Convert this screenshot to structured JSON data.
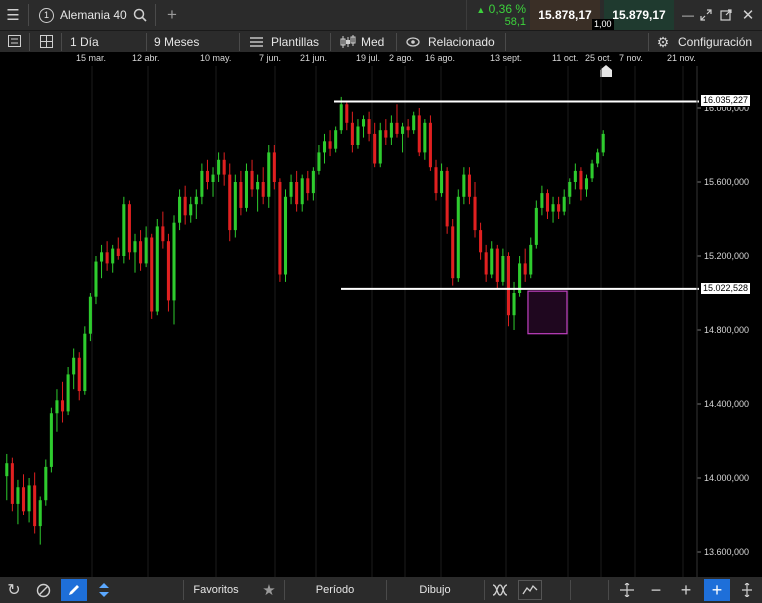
{
  "window": {
    "tab_number": "1",
    "instrument": "Alemania 40",
    "change_pct": "0,36 %",
    "change_abs": "58,1",
    "bid": "15.878,17",
    "ask": "15.879,17",
    "spread": "1,00"
  },
  "toolbar": {
    "interval": "1 Día",
    "range": "9 Meses",
    "templates": "Plantillas",
    "chart_style": "Med",
    "related": "Relacionado",
    "settings": "Configuración"
  },
  "chart_data": {
    "type": "candlestick",
    "x_tick_labels": [
      "15 mar.",
      "12 abr.",
      "10 may.",
      "7 jun.",
      "21 jun.",
      "19 jul.",
      "2 ago.",
      "16 ago.",
      "13 sept.",
      "11 oct.",
      "25 oct.",
      "7 nov.",
      "21 nov."
    ],
    "y_tick_labels": [
      "13.600,000",
      "14.000,000",
      "14.400,000",
      "14.800,000",
      "15.200,000",
      "15.600,000",
      "16.000,000"
    ],
    "ylim": [
      13500,
      16220
    ],
    "horizontal_lines": [
      {
        "label": "16.035,227",
        "value": 16035.227
      },
      {
        "label": "15.022,528",
        "value": 15022.528
      }
    ],
    "highlight_box": {
      "x_from": 94,
      "x_to": 100,
      "y_from": 14780,
      "y_to": 15010
    },
    "up_color": "#2ecc2e",
    "down_color": "#e02020",
    "candles": [
      {
        "o": 14010,
        "h": 14130,
        "l": 13880,
        "c": 14080
      },
      {
        "o": 14080,
        "h": 14110,
        "l": 13820,
        "c": 13860
      },
      {
        "o": 13860,
        "h": 13990,
        "l": 13750,
        "c": 13950
      },
      {
        "o": 13950,
        "h": 14020,
        "l": 13800,
        "c": 13820
      },
      {
        "o": 13820,
        "h": 14000,
        "l": 13760,
        "c": 13960
      },
      {
        "o": 13960,
        "h": 14030,
        "l": 13700,
        "c": 13740
      },
      {
        "o": 13740,
        "h": 13900,
        "l": 13640,
        "c": 13880
      },
      {
        "o": 13880,
        "h": 14100,
        "l": 13850,
        "c": 14060
      },
      {
        "o": 14060,
        "h": 14380,
        "l": 14030,
        "c": 14350
      },
      {
        "o": 14350,
        "h": 14480,
        "l": 14250,
        "c": 14420
      },
      {
        "o": 14420,
        "h": 14520,
        "l": 14300,
        "c": 14360
      },
      {
        "o": 14360,
        "h": 14600,
        "l": 14340,
        "c": 14560
      },
      {
        "o": 14560,
        "h": 14700,
        "l": 14480,
        "c": 14650
      },
      {
        "o": 14650,
        "h": 14680,
        "l": 14420,
        "c": 14470
      },
      {
        "o": 14470,
        "h": 14820,
        "l": 14450,
        "c": 14780
      },
      {
        "o": 14780,
        "h": 15000,
        "l": 14740,
        "c": 14980
      },
      {
        "o": 14980,
        "h": 15200,
        "l": 14940,
        "c": 15170
      },
      {
        "o": 15170,
        "h": 15260,
        "l": 15080,
        "c": 15220
      },
      {
        "o": 15220,
        "h": 15280,
        "l": 15120,
        "c": 15160
      },
      {
        "o": 15160,
        "h": 15260,
        "l": 15110,
        "c": 15240
      },
      {
        "o": 15240,
        "h": 15300,
        "l": 15180,
        "c": 15200
      },
      {
        "o": 15200,
        "h": 15520,
        "l": 15160,
        "c": 15480
      },
      {
        "o": 15480,
        "h": 15500,
        "l": 15180,
        "c": 15220
      },
      {
        "o": 15220,
        "h": 15320,
        "l": 15110,
        "c": 15280
      },
      {
        "o": 15280,
        "h": 15340,
        "l": 15120,
        "c": 15160
      },
      {
        "o": 15160,
        "h": 15360,
        "l": 15140,
        "c": 15300
      },
      {
        "o": 15300,
        "h": 15320,
        "l": 14860,
        "c": 14900
      },
      {
        "o": 14900,
        "h": 15400,
        "l": 14880,
        "c": 15360
      },
      {
        "o": 15360,
        "h": 15440,
        "l": 15240,
        "c": 15280
      },
      {
        "o": 15280,
        "h": 15320,
        "l": 14900,
        "c": 14960
      },
      {
        "o": 14960,
        "h": 15420,
        "l": 14830,
        "c": 15380
      },
      {
        "o": 15380,
        "h": 15560,
        "l": 15340,
        "c": 15520
      },
      {
        "o": 15520,
        "h": 15580,
        "l": 15370,
        "c": 15420
      },
      {
        "o": 15420,
        "h": 15520,
        "l": 15380,
        "c": 15480
      },
      {
        "o": 15480,
        "h": 15560,
        "l": 15400,
        "c": 15520
      },
      {
        "o": 15520,
        "h": 15700,
        "l": 15480,
        "c": 15660
      },
      {
        "o": 15660,
        "h": 15720,
        "l": 15560,
        "c": 15600
      },
      {
        "o": 15600,
        "h": 15680,
        "l": 15520,
        "c": 15640
      },
      {
        "o": 15640,
        "h": 15760,
        "l": 15600,
        "c": 15720
      },
      {
        "o": 15720,
        "h": 15760,
        "l": 15580,
        "c": 15640
      },
      {
        "o": 15640,
        "h": 15700,
        "l": 15280,
        "c": 15340
      },
      {
        "o": 15340,
        "h": 15640,
        "l": 15300,
        "c": 15600
      },
      {
        "o": 15600,
        "h": 15660,
        "l": 15420,
        "c": 15460
      },
      {
        "o": 15460,
        "h": 15700,
        "l": 15440,
        "c": 15660
      },
      {
        "o": 15660,
        "h": 15720,
        "l": 15520,
        "c": 15560
      },
      {
        "o": 15560,
        "h": 15640,
        "l": 15440,
        "c": 15600
      },
      {
        "o": 15600,
        "h": 15680,
        "l": 15480,
        "c": 15520
      },
      {
        "o": 15520,
        "h": 15800,
        "l": 15460,
        "c": 15760
      },
      {
        "o": 15760,
        "h": 15800,
        "l": 15560,
        "c": 15600
      },
      {
        "o": 15600,
        "h": 15620,
        "l": 15060,
        "c": 15100
      },
      {
        "o": 15100,
        "h": 15560,
        "l": 15060,
        "c": 15520
      },
      {
        "o": 15520,
        "h": 15640,
        "l": 15480,
        "c": 15600
      },
      {
        "o": 15600,
        "h": 15660,
        "l": 15440,
        "c": 15480
      },
      {
        "o": 15480,
        "h": 15640,
        "l": 15440,
        "c": 15620
      },
      {
        "o": 15620,
        "h": 15660,
        "l": 15500,
        "c": 15540
      },
      {
        "o": 15540,
        "h": 15680,
        "l": 15500,
        "c": 15660
      },
      {
        "o": 15660,
        "h": 15800,
        "l": 15640,
        "c": 15760
      },
      {
        "o": 15760,
        "h": 15860,
        "l": 15700,
        "c": 15820
      },
      {
        "o": 15820,
        "h": 15880,
        "l": 15740,
        "c": 15780
      },
      {
        "o": 15780,
        "h": 15900,
        "l": 15760,
        "c": 15880
      },
      {
        "o": 15880,
        "h": 16060,
        "l": 15860,
        "c": 16020
      },
      {
        "o": 16020,
        "h": 16040,
        "l": 15880,
        "c": 15920
      },
      {
        "o": 15920,
        "h": 15980,
        "l": 15760,
        "c": 15800
      },
      {
        "o": 15800,
        "h": 15940,
        "l": 15780,
        "c": 15900
      },
      {
        "o": 15900,
        "h": 15960,
        "l": 15840,
        "c": 15940
      },
      {
        "o": 15940,
        "h": 15980,
        "l": 15820,
        "c": 15860
      },
      {
        "o": 15860,
        "h": 15920,
        "l": 15680,
        "c": 15700
      },
      {
        "o": 15700,
        "h": 15920,
        "l": 15680,
        "c": 15880
      },
      {
        "o": 15880,
        "h": 15940,
        "l": 15800,
        "c": 15840
      },
      {
        "o": 15840,
        "h": 15960,
        "l": 15800,
        "c": 15920
      },
      {
        "o": 15920,
        "h": 16020,
        "l": 15840,
        "c": 15860
      },
      {
        "o": 15860,
        "h": 15920,
        "l": 15760,
        "c": 15900
      },
      {
        "o": 15900,
        "h": 15940,
        "l": 15840,
        "c": 15880
      },
      {
        "o": 15880,
        "h": 15980,
        "l": 15860,
        "c": 15960
      },
      {
        "o": 15960,
        "h": 16000,
        "l": 15740,
        "c": 15760
      },
      {
        "o": 15760,
        "h": 15940,
        "l": 15720,
        "c": 15920
      },
      {
        "o": 15920,
        "h": 15960,
        "l": 15660,
        "c": 15680
      },
      {
        "o": 15680,
        "h": 15720,
        "l": 15500,
        "c": 15540
      },
      {
        "o": 15540,
        "h": 15700,
        "l": 15520,
        "c": 15660
      },
      {
        "o": 15660,
        "h": 15680,
        "l": 15320,
        "c": 15360
      },
      {
        "o": 15360,
        "h": 15400,
        "l": 15040,
        "c": 15080
      },
      {
        "o": 15080,
        "h": 15560,
        "l": 15060,
        "c": 15520
      },
      {
        "o": 15520,
        "h": 15680,
        "l": 15480,
        "c": 15640
      },
      {
        "o": 15640,
        "h": 15680,
        "l": 15480,
        "c": 15520
      },
      {
        "o": 15520,
        "h": 15600,
        "l": 15300,
        "c": 15340
      },
      {
        "o": 15340,
        "h": 15380,
        "l": 15180,
        "c": 15220
      },
      {
        "o": 15220,
        "h": 15260,
        "l": 15060,
        "c": 15100
      },
      {
        "o": 15100,
        "h": 15280,
        "l": 15080,
        "c": 15240
      },
      {
        "o": 15240,
        "h": 15260,
        "l": 15020,
        "c": 15060
      },
      {
        "o": 15060,
        "h": 15240,
        "l": 15040,
        "c": 15200
      },
      {
        "o": 15200,
        "h": 15220,
        "l": 14820,
        "c": 14880
      },
      {
        "o": 14880,
        "h": 15060,
        "l": 14800,
        "c": 15000
      },
      {
        "o": 15000,
        "h": 15200,
        "l": 14980,
        "c": 15160
      },
      {
        "o": 15160,
        "h": 15240,
        "l": 15060,
        "c": 15100
      },
      {
        "o": 15100,
        "h": 15300,
        "l": 15080,
        "c": 15260
      },
      {
        "o": 15260,
        "h": 15500,
        "l": 15240,
        "c": 15460
      },
      {
        "o": 15460,
        "h": 15580,
        "l": 15420,
        "c": 15540
      },
      {
        "o": 15540,
        "h": 15560,
        "l": 15400,
        "c": 15440
      },
      {
        "o": 15440,
        "h": 15520,
        "l": 15380,
        "c": 15480
      },
      {
        "o": 15480,
        "h": 15520,
        "l": 15400,
        "c": 15440
      },
      {
        "o": 15440,
        "h": 15560,
        "l": 15420,
        "c": 15520
      },
      {
        "o": 15520,
        "h": 15620,
        "l": 15480,
        "c": 15600
      },
      {
        "o": 15600,
        "h": 15700,
        "l": 15560,
        "c": 15660
      },
      {
        "o": 15660,
        "h": 15680,
        "l": 15500,
        "c": 15560
      },
      {
        "o": 15560,
        "h": 15640,
        "l": 15520,
        "c": 15620
      },
      {
        "o": 15620,
        "h": 15720,
        "l": 15600,
        "c": 15700
      },
      {
        "o": 15700,
        "h": 15780,
        "l": 15680,
        "c": 15760
      },
      {
        "o": 15760,
        "h": 15880,
        "l": 15740,
        "c": 15860
      }
    ]
  },
  "bottombar": {
    "favorites": "Favoritos",
    "period": "Período",
    "drawing": "Dibujo"
  }
}
